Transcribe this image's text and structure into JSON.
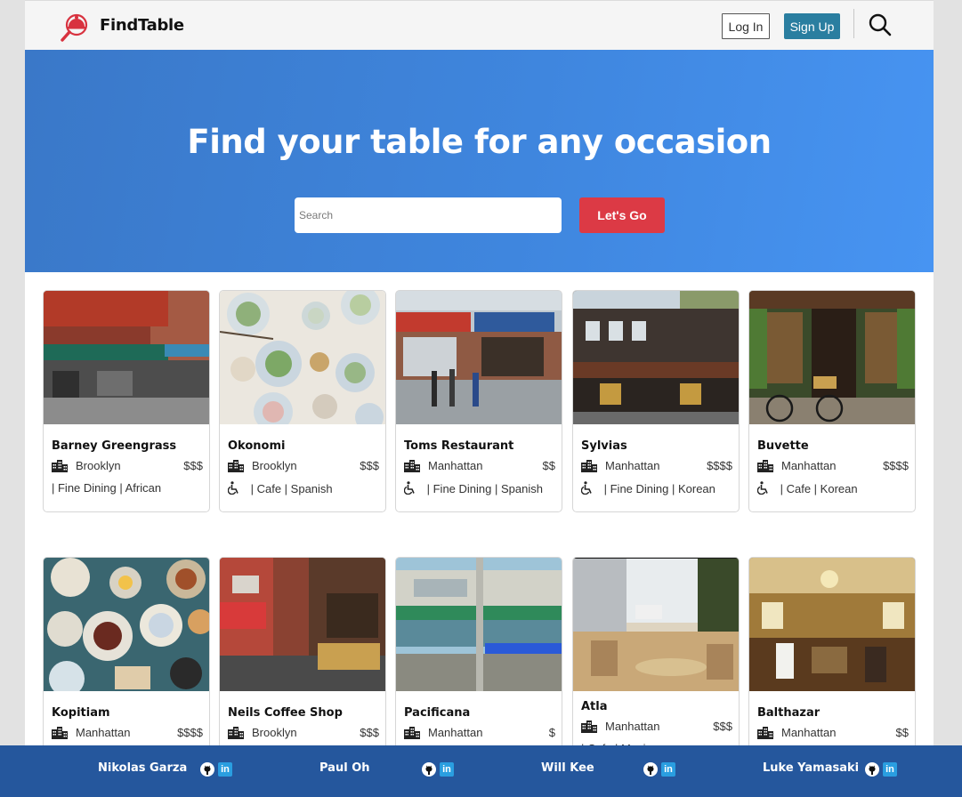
{
  "app": {
    "brand": "FindTable",
    "login_label": "Log In",
    "signup_label": "Sign Up"
  },
  "hero": {
    "title": "Find your table for any occasion",
    "search_placeholder": "Search",
    "search_value": "",
    "go_label": "Let's Go"
  },
  "restaurants": [
    {
      "name": "Barney Greengrass",
      "location": "Brooklyn",
      "price": "$$$",
      "tags": "| Fine Dining | African",
      "accessible": false
    },
    {
      "name": "Okonomi",
      "location": "Brooklyn",
      "price": "$$$",
      "tags": "| Cafe | Spanish",
      "accessible": true
    },
    {
      "name": "Toms Restaurant",
      "location": "Manhattan",
      "price": "$$",
      "tags": "| Fine Dining | Spanish",
      "accessible": true
    },
    {
      "name": "Sylvias",
      "location": "Manhattan",
      "price": "$$$$",
      "tags": "| Fine Dining | Korean",
      "accessible": true
    },
    {
      "name": "Buvette",
      "location": "Manhattan",
      "price": "$$$$",
      "tags": "| Cafe | Korean",
      "accessible": true
    },
    {
      "name": "Kopitiam",
      "location": "Manhattan",
      "price": "$$$$",
      "tags": "",
      "accessible": false
    },
    {
      "name": "Neils Coffee Shop",
      "location": "Brooklyn",
      "price": "$$$",
      "tags": "",
      "accessible": false
    },
    {
      "name": "Pacificana",
      "location": "Manhattan",
      "price": "$",
      "tags": "",
      "accessible": false
    },
    {
      "name": "Atla",
      "location": "Manhattan",
      "price": "$$$",
      "tags": "| Cafe | Mexican",
      "accessible": false
    },
    {
      "name": "Balthazar",
      "location": "Manhattan",
      "price": "$$",
      "tags": "",
      "accessible": false
    }
  ],
  "footer": {
    "members": [
      "Nikolas Garza",
      "Paul Oh",
      "Will Kee",
      "Luke Yamasaki"
    ],
    "linkedin_label": "in"
  },
  "icons": {
    "logo": "magnifier-cloche-icon",
    "search": "search-icon",
    "location": "buildings-icon",
    "accessibility": "wheelchair-icon",
    "github": "github-icon",
    "linkedin": "linkedin-icon"
  },
  "colors": {
    "hero_start": "#3a78c8",
    "hero_end": "#4794f2",
    "go_button": "#dc3a45",
    "signup_button": "#2a7ea0",
    "footer": "#25579d",
    "logo": "#d8323f"
  }
}
